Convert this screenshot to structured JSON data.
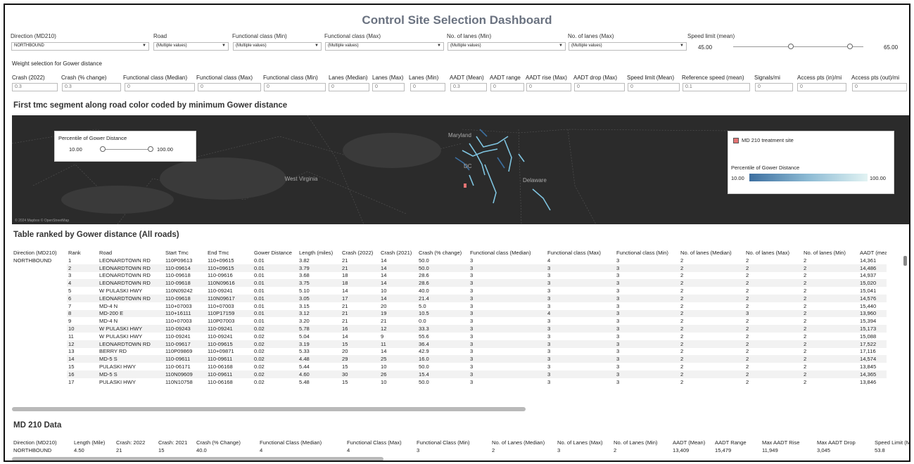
{
  "title": "Control Site Selection Dashboard",
  "filters": [
    {
      "label": "Direction (MD210)",
      "value": "NORTHBOUND"
    },
    {
      "label": "Road",
      "value": "(Multiple values)"
    },
    {
      "label": "Functional class (Min)",
      "value": "(Multiple values)"
    },
    {
      "label": "Functional class (Max)",
      "value": "(Multiple values)"
    },
    {
      "label": "No. of lanes (Min)",
      "value": "(Multiple values)"
    },
    {
      "label": "No. of lanes (Max)",
      "value": "(Multiple values)"
    }
  ],
  "speed": {
    "label": "Speed limit (mean)",
    "min": "45.00",
    "max": "65.00"
  },
  "weights": {
    "title": "Weight selection for Gower distance",
    "items": [
      {
        "label": "Crash (2022)",
        "value": "0.3"
      },
      {
        "label": "Crash (% change)",
        "value": "0.3"
      },
      {
        "label": "Functional class (Median)",
        "value": "0"
      },
      {
        "label": "Functional class (Max)",
        "value": "0"
      },
      {
        "label": "Functional class (Min)",
        "value": "0"
      },
      {
        "label": "Lanes (Median)",
        "value": "0"
      },
      {
        "label": "Lanes (Max)",
        "value": "0"
      },
      {
        "label": "Lanes (Min)",
        "value": "0"
      },
      {
        "label": "AADT (Mean)",
        "value": "0.3"
      },
      {
        "label": "AADT range",
        "value": "0"
      },
      {
        "label": "AADT rise (Max)",
        "value": "0"
      },
      {
        "label": "AADT drop (Max)",
        "value": "0"
      },
      {
        "label": "Speed limit (Mean)",
        "value": "0"
      },
      {
        "label": "Reference speed (mean)",
        "value": "0.1"
      },
      {
        "label": "Signals/mi",
        "value": "0"
      },
      {
        "label": "Access pts (in)/mi",
        "value": "0"
      },
      {
        "label": "Access pts (out)/mi",
        "value": "0"
      }
    ]
  },
  "map": {
    "title": "First tmc segment along road color coded by minimum Gower distance",
    "places": [
      "Maryland",
      "DC",
      "West Virginia",
      "Delaware"
    ],
    "percentile_label": "Percentile of Gower Distance",
    "percentile_min": "10.00",
    "percentile_max": "100.00",
    "legend_site": "MD 210 treatment site",
    "legend_title": "Percentile of Gower Distance",
    "legend_min": "10.00",
    "legend_max": "100.00",
    "attribution": "© 2024 Mapbox © OpenStreetMap"
  },
  "ranked": {
    "title": "Table ranked by Gower distance (All roads)",
    "direction": "NORTHBOUND",
    "columns": [
      "Direction (MD210)",
      "Rank",
      "Road",
      "Start Tmc",
      "End Tmc",
      "Gower Distance",
      "Length (miles)",
      "Crash (2022)",
      "Crash (2021)",
      "Crash (% change)",
      "Functional class (Median)",
      "Functional class (Max)",
      "Functional class (Min)",
      "No. of lanes (Median)",
      "No. of lanes (Max)",
      "No. of lanes (Min)",
      "AADT (mea"
    ],
    "rows": [
      [
        "1",
        "LEONARDTOWN RD",
        "110P09613",
        "110+09615",
        "0.01",
        "3.82",
        "21",
        "14",
        "50.0",
        "3",
        "4",
        "3",
        "2",
        "2",
        "2",
        "14,361"
      ],
      [
        "2",
        "LEONARDTOWN RD",
        "110-09614",
        "110+09615",
        "0.01",
        "3.79",
        "21",
        "14",
        "50.0",
        "3",
        "3",
        "3",
        "2",
        "2",
        "2",
        "14,486"
      ],
      [
        "3",
        "LEONARDTOWN RD",
        "110-09618",
        "110-09616",
        "0.01",
        "3.68",
        "18",
        "14",
        "28.6",
        "3",
        "3",
        "3",
        "2",
        "2",
        "2",
        "14,937"
      ],
      [
        "4",
        "LEONARDTOWN RD",
        "110-09618",
        "110N09616",
        "0.01",
        "3.75",
        "18",
        "14",
        "28.6",
        "3",
        "3",
        "3",
        "2",
        "2",
        "2",
        "15,020"
      ],
      [
        "5",
        "W PULASKI HWY",
        "110N09242",
        "110-09241",
        "0.01",
        "5.10",
        "14",
        "10",
        "40.0",
        "3",
        "3",
        "3",
        "2",
        "2",
        "2",
        "15,041"
      ],
      [
        "6",
        "LEONARDTOWN RD",
        "110-09618",
        "110N09617",
        "0.01",
        "3.05",
        "17",
        "14",
        "21.4",
        "3",
        "3",
        "3",
        "2",
        "2",
        "2",
        "14,576"
      ],
      [
        "7",
        "MD-4 N",
        "110+07003",
        "110+07003",
        "0.01",
        "3.15",
        "21",
        "20",
        "5.0",
        "3",
        "3",
        "3",
        "2",
        "2",
        "2",
        "15,440"
      ],
      [
        "8",
        "MD-200 E",
        "110+16111",
        "110P17159",
        "0.01",
        "3.12",
        "21",
        "19",
        "10.5",
        "3",
        "4",
        "3",
        "2",
        "3",
        "2",
        "13,960"
      ],
      [
        "9",
        "MD-4 N",
        "110+07003",
        "110P07003",
        "0.01",
        "3.20",
        "21",
        "21",
        "0.0",
        "3",
        "3",
        "3",
        "2",
        "2",
        "2",
        "15,394"
      ],
      [
        "10",
        "W PULASKI HWY",
        "110-09243",
        "110-09241",
        "0.02",
        "5.78",
        "16",
        "12",
        "33.3",
        "3",
        "3",
        "3",
        "2",
        "2",
        "2",
        "15,173"
      ],
      [
        "11",
        "W PULASKI HWY",
        "110-09241",
        "110-09241",
        "0.02",
        "5.04",
        "14",
        "9",
        "55.6",
        "3",
        "3",
        "3",
        "2",
        "2",
        "2",
        "15,088"
      ],
      [
        "12",
        "LEONARDTOWN RD",
        "110-09617",
        "110-09615",
        "0.02",
        "3.19",
        "15",
        "11",
        "36.4",
        "3",
        "3",
        "3",
        "2",
        "2",
        "2",
        "17,522"
      ],
      [
        "13",
        "BERRY RD",
        "110P09869",
        "110+09871",
        "0.02",
        "5.33",
        "20",
        "14",
        "42.9",
        "3",
        "3",
        "3",
        "2",
        "2",
        "2",
        "17,116"
      ],
      [
        "14",
        "MD-5 S",
        "110-09611",
        "110-09611",
        "0.02",
        "4.48",
        "29",
        "25",
        "16.0",
        "3",
        "3",
        "3",
        "2",
        "2",
        "2",
        "14,574"
      ],
      [
        "15",
        "PULASKI HWY",
        "110-06171",
        "110-06168",
        "0.02",
        "5.44",
        "15",
        "10",
        "50.0",
        "3",
        "3",
        "3",
        "2",
        "2",
        "2",
        "13,845"
      ],
      [
        "16",
        "MD-5 S",
        "110N09609",
        "110-09611",
        "0.02",
        "4.60",
        "30",
        "26",
        "15.4",
        "3",
        "3",
        "3",
        "2",
        "2",
        "2",
        "14,365"
      ],
      [
        "17",
        "PULASKI HWY",
        "110N10758",
        "110-06168",
        "0.02",
        "5.48",
        "15",
        "10",
        "50.0",
        "3",
        "3",
        "3",
        "2",
        "2",
        "2",
        "13,846"
      ]
    ]
  },
  "md210": {
    "title": "MD 210 Data",
    "columns": [
      "Direction (MD210)",
      "Length (Mile)",
      "Crash: 2022",
      "Crash: 2021",
      "Crash (% Change)",
      "Functional Class (Median)",
      "Functional Class (Max)",
      "Functional Class (Min)",
      "No. of Lanes (Median)",
      "No. of Lanes (Max)",
      "No. of Lanes (Min)",
      "AADT (Mean)",
      "AADT Range",
      "Max AADT Rise",
      "Max AADT Drop",
      "Speed Limit (Mea"
    ],
    "row": [
      "NORTHBOUND",
      "4.50",
      "21",
      "15",
      "40.0",
      "4",
      "4",
      "3",
      "2",
      "3",
      "2",
      "13,409",
      "15,479",
      "11,949",
      "3,045",
      "53.8"
    ]
  }
}
